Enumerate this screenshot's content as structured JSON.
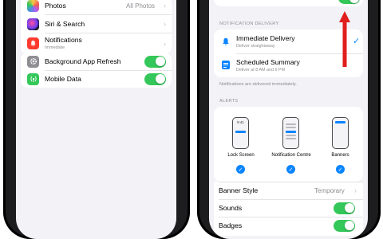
{
  "left_screen": {
    "rows": [
      {
        "label": "Photos",
        "value": "All Photos",
        "icon": "photos-icon"
      },
      {
        "label": "Siri & Search",
        "value": "",
        "icon": "siri-icon"
      },
      {
        "label": "Notifications",
        "sublabel": "Immediate",
        "value": "",
        "icon": "bell-icon"
      },
      {
        "label": "Background App Refresh",
        "value": "",
        "icon": "gear-icon",
        "toggle": true
      },
      {
        "label": "Mobile Data",
        "value": "",
        "icon": "antenna-icon",
        "toggle": true
      }
    ]
  },
  "right_screen": {
    "notification_delivery": {
      "header": "NOTIFICATION DELIVERY",
      "immediate_label": "Immediate Delivery",
      "immediate_sub": "Deliver straightaway",
      "scheduled_label": "Scheduled Summary",
      "scheduled_sub": "Deliver at 8 AM and 6 PM",
      "footer": "Notifications are delivered immediately."
    },
    "alerts": {
      "header": "ALERTS",
      "mini_time": "9:41",
      "styles": [
        "Lock Screen",
        "Notification Centre",
        "Banners"
      ],
      "banner_style_label": "Banner Style",
      "banner_style_value": "Temporary",
      "sounds_label": "Sounds",
      "badges_label": "Badges"
    }
  },
  "colors": {
    "accent": "#0a84ff",
    "toggle_on": "#34c759",
    "arrow": "#e01e1e"
  }
}
